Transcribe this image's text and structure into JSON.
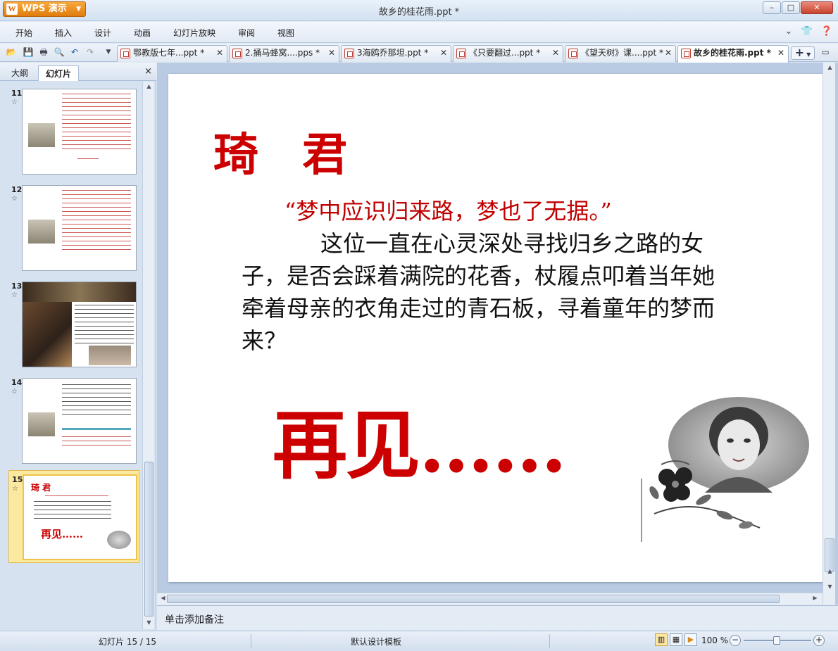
{
  "app": {
    "button_label": "WPS 演示",
    "window_title": "故乡的桂花雨.ppt *",
    "window_buttons": {
      "minimize": "–",
      "maximize": "□",
      "close": "✕"
    }
  },
  "menu": {
    "items": [
      "开始",
      "插入",
      "设计",
      "动画",
      "幻灯片放映",
      "审阅",
      "视图"
    ],
    "right_icons": [
      "chevron-down-icon",
      "shirt-icon",
      "help-icon"
    ]
  },
  "quick_access": [
    "open-icon",
    "save-icon",
    "print-icon",
    "print-preview-icon",
    "undo-icon",
    "redo-icon",
    "customize-icon"
  ],
  "doc_tabs": [
    {
      "label": "鄂教版七年...ppt *",
      "active": false
    },
    {
      "label": "2.捅马蜂窝....pps *",
      "active": false
    },
    {
      "label": "3海鸥乔那坦.ppt *",
      "active": false
    },
    {
      "label": "《只要翻过...ppt *",
      "active": false
    },
    {
      "label": "《望天树》课....ppt *",
      "active": false
    },
    {
      "label": "故乡的桂花雨.ppt *",
      "active": true
    }
  ],
  "tab_add_label": "+",
  "left_panel": {
    "tab_outline": "大纲",
    "tab_slides": "幻灯片",
    "close": "×",
    "thumbnails": [
      {
        "number": "11",
        "star": "☆",
        "selected": false
      },
      {
        "number": "12",
        "star": "☆",
        "selected": false
      },
      {
        "number": "13",
        "star": "☆",
        "selected": false
      },
      {
        "number": "14",
        "star": "☆",
        "selected": false
      },
      {
        "number": "15",
        "star": "☆",
        "selected": true
      }
    ],
    "thumb15": {
      "title": "琦 君",
      "farewell": "再见……"
    }
  },
  "slide": {
    "title": "琦 君",
    "quote": "“梦中应识归来路，梦也了无据。”",
    "body": "这位一直在心灵深处寻找归乡之路的女子，是否会踩着满院的花香，杖履点叩着当年她牵着母亲的衣角走过的青石板，寻着童年的梦而来？",
    "farewell": "再见……"
  },
  "notes_placeholder": "单击添加备注",
  "status": {
    "slide_counter": "幻灯片 15 / 15",
    "template": "默认设计模板",
    "zoom": "100 %",
    "zoom_fraction": 0.5
  }
}
